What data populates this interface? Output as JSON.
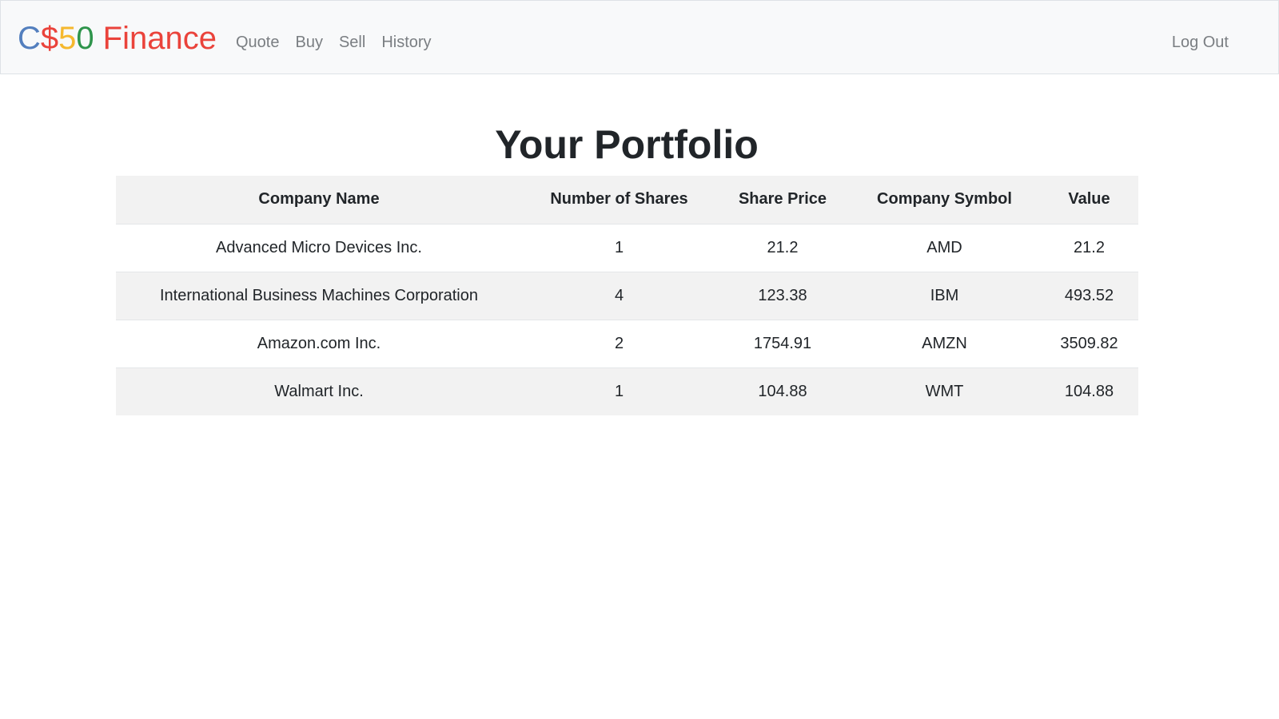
{
  "brand": {
    "c": "C",
    "dollar": "$",
    "five": "5",
    "zero": "0",
    "finance": "Finance"
  },
  "nav": {
    "items": [
      {
        "label": "Quote"
      },
      {
        "label": "Buy"
      },
      {
        "label": "Sell"
      },
      {
        "label": "History"
      }
    ],
    "logout_label": "Log Out"
  },
  "main": {
    "title": "Your Portfolio",
    "table": {
      "headers": [
        "Company Name",
        "Number of Shares",
        "Share Price",
        "Company Symbol",
        "Value"
      ],
      "rows": [
        [
          "Advanced Micro Devices Inc.",
          "1",
          "21.2",
          "AMD",
          "21.2"
        ],
        [
          "International Business Machines Corporation",
          "4",
          "123.38",
          "IBM",
          "493.52"
        ],
        [
          "Amazon.com Inc.",
          "2",
          "1754.91",
          "AMZN",
          "3509.82"
        ],
        [
          "Walmart Inc.",
          "1",
          "104.88",
          "WMT",
          "104.88"
        ]
      ]
    }
  },
  "colors": {
    "brand_blue": "#537fbe",
    "brand_red": "#ea433b",
    "brand_yellow": "#f5b82e",
    "brand_green": "#2e944b",
    "navbar_bg": "#f8f9fa",
    "striped_row": "#f2f2f2"
  }
}
